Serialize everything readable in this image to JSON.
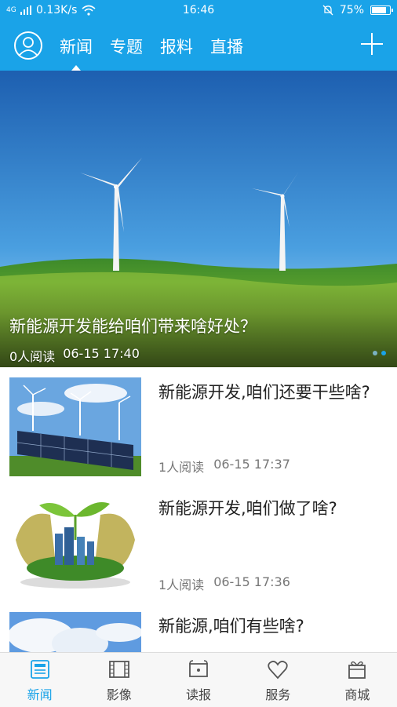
{
  "status_bar": {
    "network": "4G",
    "speed": "0.13K/s",
    "time": "16:46",
    "battery": "75%",
    "battery_level": 0.75
  },
  "header": {
    "tabs": [
      {
        "label": "新闻",
        "active": true
      },
      {
        "label": "专题",
        "active": false
      },
      {
        "label": "报料",
        "active": false
      },
      {
        "label": "直播",
        "active": false
      }
    ]
  },
  "hero": {
    "title": "新能源开发能给咱们带来啥好处？",
    "reads": "0人阅读",
    "time": "06-15 17:40"
  },
  "news": [
    {
      "title": "新能源开发,咱们还要干些啥?",
      "reads": "1人阅读",
      "time": "06-15 17:37",
      "image": "solar-panels-wind-turbines"
    },
    {
      "title": "新能源开发,咱们做了啥?",
      "reads": "1人阅读",
      "time": "06-15 17:36",
      "image": "green-city-eggshell"
    },
    {
      "title": "新能源,咱们有些啥?",
      "reads": "",
      "time": "",
      "image": "clouds-sky"
    }
  ],
  "bottom_nav": [
    {
      "label": "新闻",
      "icon": "news-icon",
      "active": true
    },
    {
      "label": "影像",
      "icon": "film-icon",
      "active": false
    },
    {
      "label": "读报",
      "icon": "newspaper-icon",
      "active": false
    },
    {
      "label": "服务",
      "icon": "heart-icon",
      "active": false
    },
    {
      "label": "商城",
      "icon": "gift-icon",
      "active": false
    }
  ],
  "colors": {
    "accent": "#1aa3e8"
  }
}
